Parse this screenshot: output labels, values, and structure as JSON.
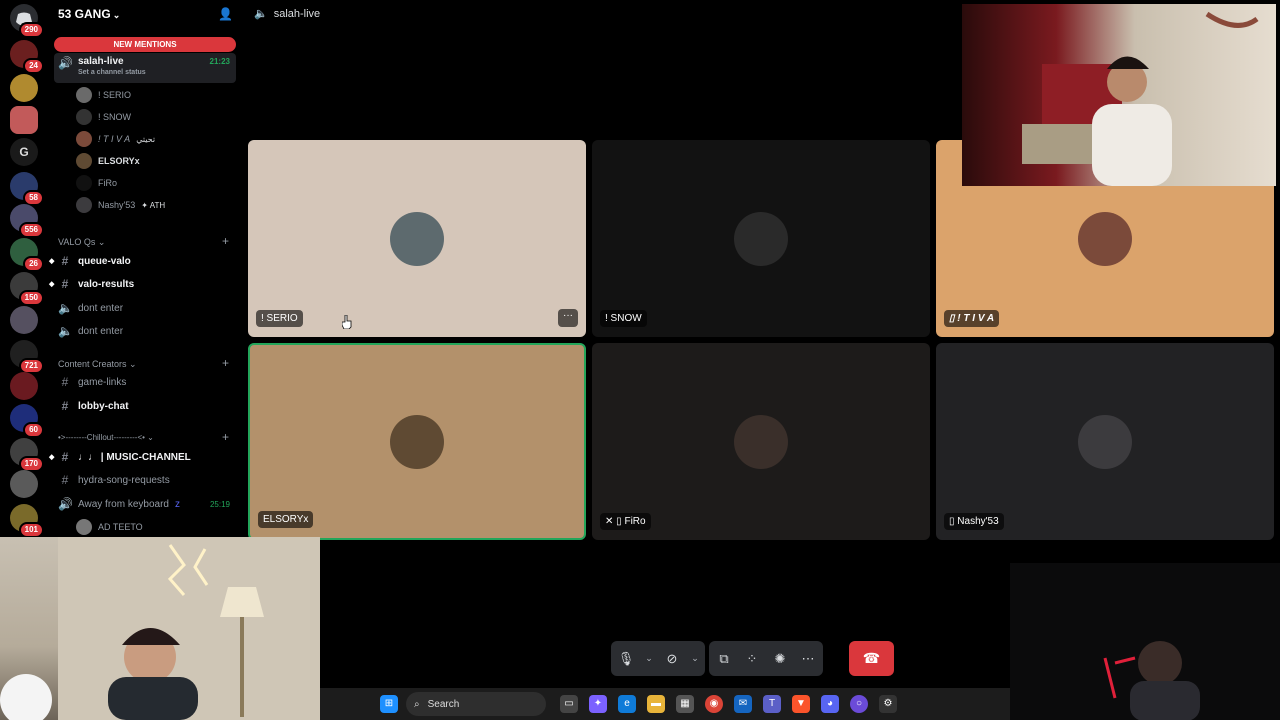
{
  "window": {
    "channel_title": "salah-live"
  },
  "server": {
    "name": "53 GANG",
    "new_mentions": "NEW MENTIONS"
  },
  "rail_badges": [
    "290",
    "24",
    "58",
    "556",
    "26",
    "150",
    "721",
    "60",
    "170",
    "101"
  ],
  "rail_letter": "G",
  "channels": {
    "active": {
      "name": "salah-live",
      "status": "Set a channel status",
      "time": "21:23"
    },
    "voice_users": [
      "! SERIO",
      "! SNOW",
      "! T I V A",
      "ELSORYx",
      "FiRo",
      "Nashy'53"
    ],
    "voice_user_tags": {
      "tiva": "تحيتي",
      "nashy": "ATH"
    },
    "cat_valo": "VALO Qs",
    "queue_valo": "queue-valo",
    "valo_results": "valo-results",
    "dont_enter_1": "dont enter",
    "dont_enter_2": "dont enter",
    "cat_creators": "Content Creators",
    "game_links": "game-links",
    "lobby_chat": "lobby-chat",
    "cat_chillout": "•>--------Chillout---------<•",
    "music_channel": "♩♩ | MUSIC-CHANNEL",
    "hydra": "hydra-song-requests",
    "afk": "Away from keyboard",
    "afk_time": "25:19",
    "afk_user": "AD TEETO"
  },
  "tiles": [
    {
      "name": "! SERIO",
      "bg": "#d5c6b9",
      "pfp": "#5d6a6e"
    },
    {
      "name": "! SNOW",
      "bg": "#121212",
      "pfp": "#2a2a2a"
    },
    {
      "name": "! T I V A",
      "bg": "#dba36b",
      "pfp": "#7b4a3a"
    },
    {
      "name": "ELSORYx",
      "bg": "#b3916b",
      "pfp": "#5f4a33"
    },
    {
      "name": "FiRo",
      "bg": "#1d1b1a",
      "pfp": "#3a2f2a"
    },
    {
      "name": "Nashy'53",
      "bg": "#222224",
      "pfp": "#3c3b3e"
    }
  ],
  "taskbar": {
    "search_placeholder": "Search"
  },
  "colors": {
    "accent_red": "#da373c",
    "speaking_green": "#23a55a",
    "bg": "#000000"
  }
}
